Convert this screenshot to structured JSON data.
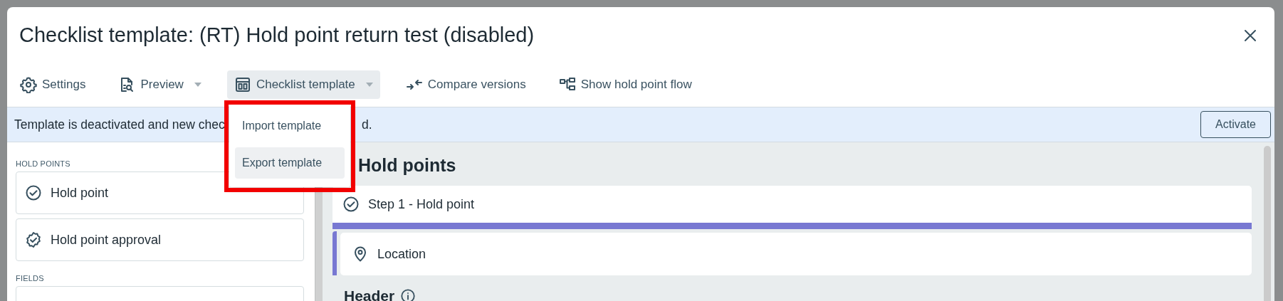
{
  "dialog": {
    "title": "Checklist template: (RT) Hold point return test (disabled)"
  },
  "toolbar": [
    {
      "kind": "settings",
      "label": "Settings",
      "has_menu": false,
      "expanded": false
    },
    {
      "kind": "preview",
      "label": "Preview",
      "has_menu": true,
      "expanded": false
    },
    {
      "kind": "template",
      "label": "Checklist template",
      "has_menu": true,
      "expanded": true
    },
    {
      "kind": "compare",
      "label": "Compare versions",
      "has_menu": false,
      "expanded": false
    },
    {
      "kind": "flow",
      "label": "Show hold point flow",
      "has_menu": false,
      "expanded": false
    }
  ],
  "menu": {
    "items": [
      {
        "label": "Import template",
        "selected": false
      },
      {
        "label": "Export template",
        "selected": true
      }
    ]
  },
  "banner": {
    "text_parts": [
      "Template is deactivated and new chec",
      "d."
    ],
    "button": "Activate"
  },
  "sidebar": {
    "sections": [
      {
        "heading": "HOLD POINTS",
        "items": [
          {
            "kind": "check",
            "label": "Hold point"
          },
          {
            "kind": "approval",
            "label": "Hold point approval"
          }
        ]
      },
      {
        "heading": "FIELDS",
        "items": [
          {
            "kind": "empty"
          }
        ]
      }
    ]
  },
  "main": {
    "heading": "Hold points",
    "steps": [
      {
        "label": "Step 1 - Hold point",
        "fields": [
          {
            "kind": "location",
            "label": "Location"
          }
        ]
      }
    ],
    "next_heading": "Header"
  }
}
